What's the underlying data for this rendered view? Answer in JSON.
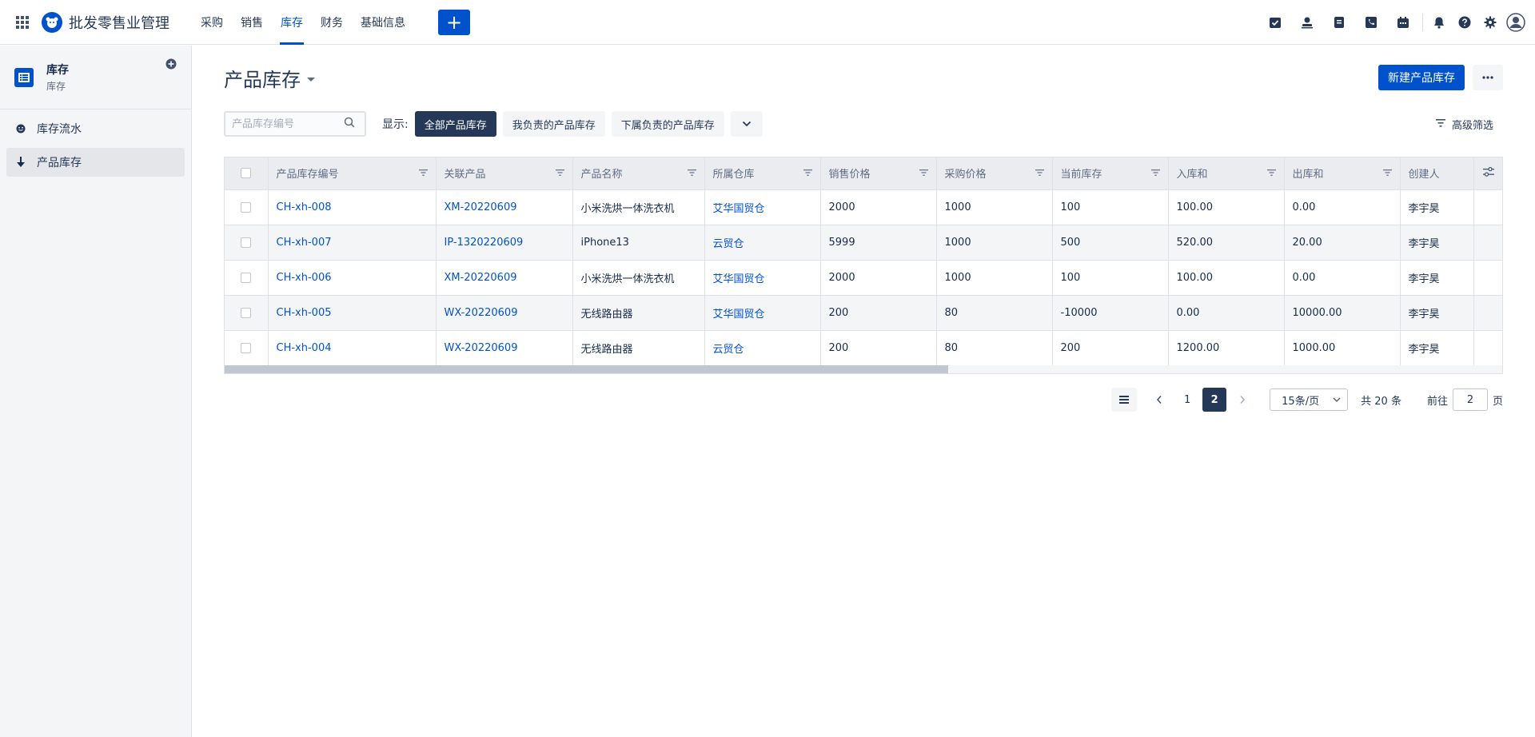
{
  "topbar": {
    "app_title": "批发零售业管理",
    "nav": [
      {
        "label": "采购"
      },
      {
        "label": "销售"
      },
      {
        "label": "库存"
      },
      {
        "label": "财务"
      },
      {
        "label": "基础信息"
      }
    ],
    "create_label": "+",
    "icons": [
      "checklist-icon",
      "user-stamp-icon",
      "document-icon",
      "phone-icon",
      "calendar-icon",
      "bell-icon",
      "help-icon",
      "gear-icon",
      "avatar-icon"
    ]
  },
  "sidebar": {
    "project_name": "库存",
    "project_sub": "库存",
    "items": [
      {
        "label": "库存流水"
      },
      {
        "label": "产品库存"
      }
    ]
  },
  "page": {
    "title": "产品库存",
    "new_button": "新建产品库存",
    "more_label": "•••"
  },
  "filters": {
    "search_placeholder": "产品库存编号",
    "show_label": "显示:",
    "segments": [
      {
        "label": "全部产品库存"
      },
      {
        "label": "我负责的产品库存"
      },
      {
        "label": "下属负责的产品库存"
      }
    ],
    "advanced_label": "高级筛选"
  },
  "table": {
    "headers": [
      "产品库存编号",
      "关联产品",
      "产品名称",
      "所属仓库",
      "销售价格",
      "采购价格",
      "当前库存",
      "入库和",
      "出库和",
      "创建人"
    ],
    "rows": [
      [
        "CH-xh-008",
        "XM-20220609",
        "小米洗烘一体洗衣机",
        "艾华国贸仓",
        "2000",
        "1000",
        "100",
        "100.00",
        "0.00",
        "李宇昊"
      ],
      [
        "CH-xh-007",
        "IP-1320220609",
        "iPhone13",
        "云贸仓",
        "5999",
        "1000",
        "500",
        "520.00",
        "20.00",
        "李宇昊"
      ],
      [
        "CH-xh-006",
        "XM-20220609",
        "小米洗烘一体洗衣机",
        "艾华国贸仓",
        "2000",
        "1000",
        "100",
        "100.00",
        "0.00",
        "李宇昊"
      ],
      [
        "CH-xh-005",
        "WX-20220609",
        "无线路由器",
        "艾华国贸仓",
        "200",
        "80",
        "-10000",
        "0.00",
        "10000.00",
        "李宇昊"
      ],
      [
        "CH-xh-004",
        "WX-20220609",
        "无线路由器",
        "云贸仓",
        "200",
        "80",
        "200",
        "1200.00",
        "1000.00",
        "李宇昊"
      ]
    ]
  },
  "pager": {
    "pages": [
      "1",
      "2"
    ],
    "current": "2",
    "page_size": "15条/页",
    "total": "共 20 条",
    "goto_label": "前往",
    "goto_value": "2",
    "page_suffix": "页"
  },
  "colors": {
    "primary": "#0052cc",
    "dark": "#253858"
  }
}
